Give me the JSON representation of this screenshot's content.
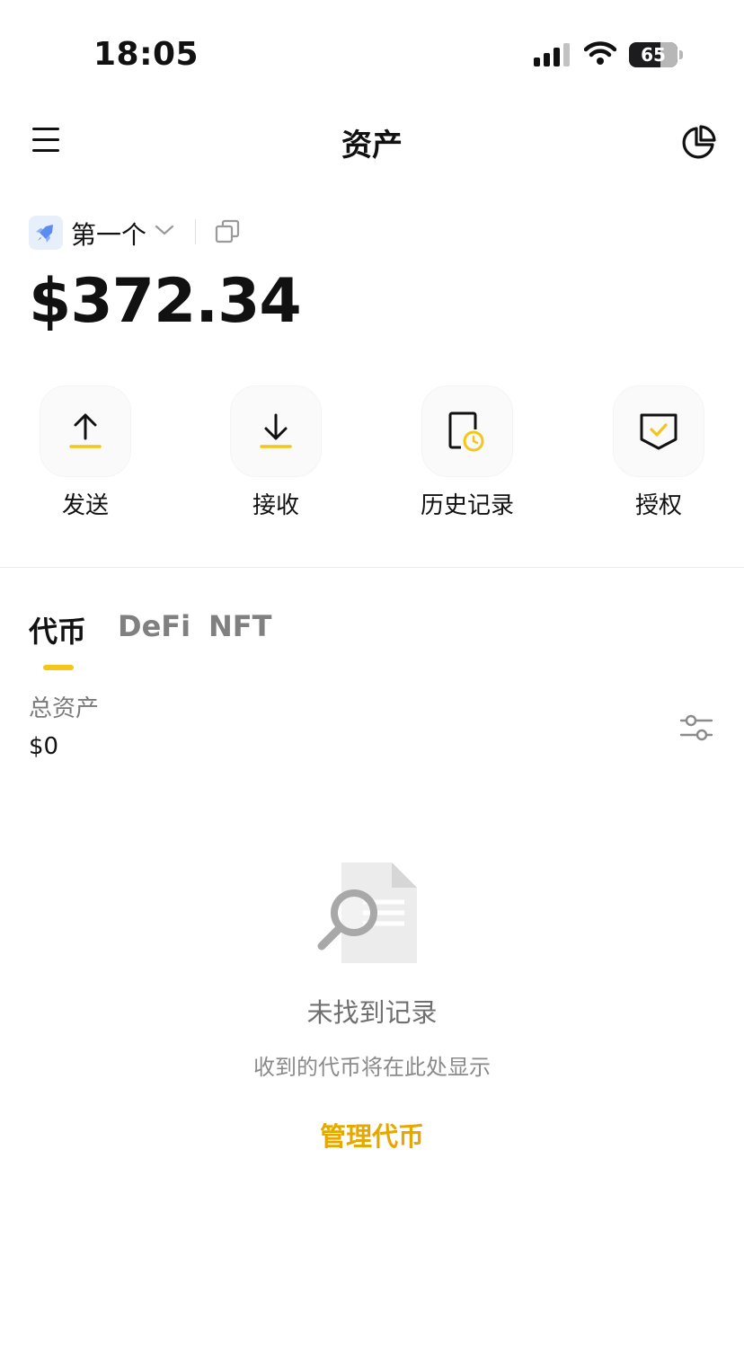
{
  "status_bar": {
    "time": "18:05",
    "battery_percent": "65",
    "battery_level": 0.65,
    "icons": [
      "cellular-signal-icon",
      "wifi-icon",
      "battery-icon"
    ]
  },
  "nav": {
    "title": "资产",
    "menu_icon": "menu-icon",
    "chart_icon": "pie-chart-icon"
  },
  "wallet": {
    "name": "第一个",
    "balance": "$372.34",
    "avatar_icon": "rocket-icon",
    "chevron_icon": "chevron-down-icon",
    "copy_icon": "copy-icon"
  },
  "actions": [
    {
      "label": "发送",
      "icon": "upload-arrow-icon"
    },
    {
      "label": "接收",
      "icon": "download-arrow-icon"
    },
    {
      "label": "历史记录",
      "icon": "history-clock-icon"
    },
    {
      "label": "授权",
      "icon": "shield-check-icon"
    }
  ],
  "tabs": [
    {
      "label": "代币",
      "active": true
    },
    {
      "label": "DeFi",
      "active": false
    },
    {
      "label": "NFT",
      "active": false
    }
  ],
  "total": {
    "label": "总资产",
    "value": "$0",
    "filter_icon": "sliders-icon"
  },
  "empty_state": {
    "title": "未找到记录",
    "subtitle": "收到的代币将在此处显示",
    "action": "管理代币",
    "icon": "search-document-icon"
  },
  "colors": {
    "accent": "#f5c518",
    "link": "#e6a800",
    "text": "#111111",
    "muted": "#808080"
  }
}
